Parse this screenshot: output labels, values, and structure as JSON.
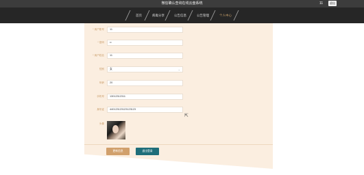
{
  "header": {
    "title": "微信确认查询在线云盘系统",
    "user": "11",
    "logout_label": "退出"
  },
  "nav": {
    "items": [
      {
        "label": "首页",
        "active": false
      },
      {
        "label": "病毒分享",
        "active": false
      },
      {
        "label": "公告信息",
        "active": false
      },
      {
        "label": "公告管理",
        "active": false
      },
      {
        "label": "个人中心",
        "active": true
      }
    ]
  },
  "form": {
    "fields": [
      {
        "label": "* 用户账号",
        "value": "11"
      },
      {
        "label": "* 密码",
        "value": "••"
      },
      {
        "label": "* 用户姓名",
        "value": "11"
      },
      {
        "label": "性别",
        "value": "女"
      },
      {
        "label": "年龄",
        "value": "20"
      },
      {
        "label": "手机号",
        "value": "13012312311"
      },
      {
        "label": "身份证",
        "value": "440123123123123123"
      }
    ],
    "avatar_label": "头像",
    "update_label": "更新信息",
    "back_label": "退出登录"
  },
  "colors": {
    "accent": "#c8a06b",
    "panel": "#fbeee0",
    "nav_bg": "#262626",
    "back_button": "#1f6e7a"
  }
}
